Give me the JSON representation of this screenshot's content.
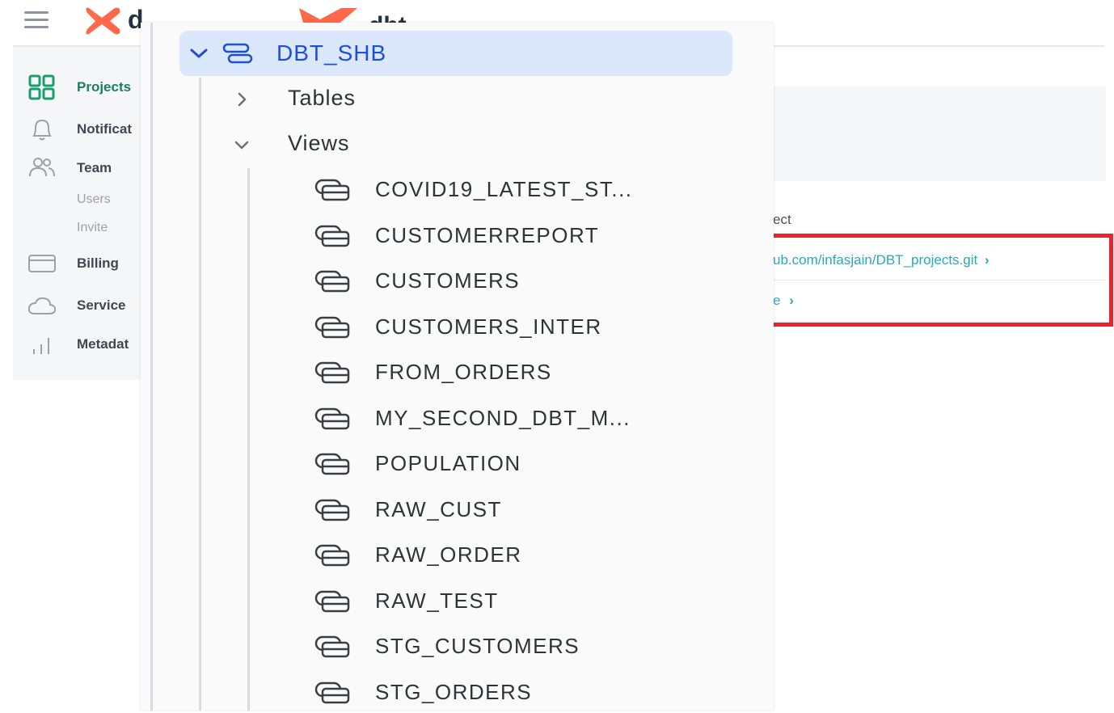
{
  "background_app": {
    "logo_text_1": "d",
    "logo_text_2": "dbt",
    "sidebar": {
      "items": [
        {
          "label": "Projects",
          "icon": "grid-icon",
          "active": true
        },
        {
          "label": "Notificat",
          "icon": "bell-icon"
        },
        {
          "label": "Team",
          "icon": "users-icon"
        },
        {
          "label": "Users",
          "sub": true
        },
        {
          "label": "Invite",
          "sub": true
        },
        {
          "label": "Billing",
          "icon": "card-icon"
        },
        {
          "label": "Service ",
          "icon": "cloud-icon"
        },
        {
          "label": "Metadat",
          "icon": "bar-chart-icon"
        }
      ]
    },
    "main": {
      "project_label": "ect",
      "repo_link": "ub.com/infasjain/DBT_projects.git",
      "second_link": "e"
    },
    "colors": {
      "accent": "#1b9e6e",
      "link": "#2aa8b8",
      "highlight": "#e8242c",
      "logo": "#ff694a"
    }
  },
  "tree": {
    "database": {
      "label": "DBT_SHB",
      "expanded": true
    },
    "folders": [
      {
        "label": "Tables",
        "expanded": false
      },
      {
        "label": "Views",
        "expanded": true
      }
    ],
    "views": [
      "COVID19_LATEST_ST...",
      "CUSTOMERREPORT",
      "CUSTOMERS",
      "CUSTOMERS_INTER",
      "FROM_ORDERS",
      "MY_SECOND_DBT_M...",
      "POPULATION",
      "RAW_CUST",
      "RAW_ORDER",
      "RAW_TEST",
      "STG_CUSTOMERS",
      "STG_ORDERS"
    ],
    "colors": {
      "selected_bg": "#dbe8fb",
      "selected_text": "#1f4fd6",
      "text": "#2f3338"
    }
  }
}
